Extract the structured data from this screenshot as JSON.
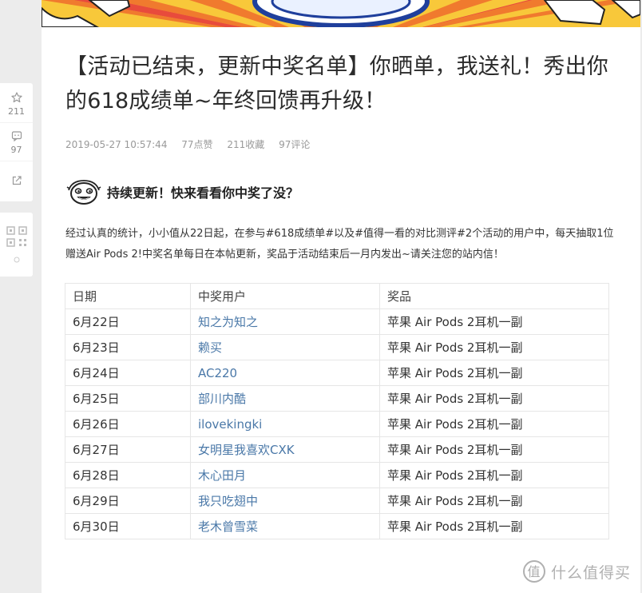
{
  "sidebar": {
    "favorite": {
      "icon": "star-icon",
      "count": "211"
    },
    "comment": {
      "icon": "comment-icon",
      "count": "97"
    },
    "share": {
      "icon": "share-icon"
    },
    "qr": {
      "icon": "qr-code-icon"
    }
  },
  "article": {
    "title": "【活动已结束，更新中奖名单】你晒单，我送礼！秀出你的618成绩单~年终回馈再升级！",
    "meta": {
      "timestamp": "2019-05-27 10:57:44",
      "likes": "77点赞",
      "favorites": "211收藏",
      "comments": "97评论"
    },
    "section_heading": "持续更新！快来看看你中奖了没？",
    "intro": "经过认真的统计，小小值从22日起，在参与#618成绩单#以及#值得一看的对比测评#2个活动的用户中，每天抽取1位赠送Air Pods 2!中奖名单每日在本帖更新，奖品于活动结束后一月内发出~请关注您的站内信！",
    "table": {
      "headers": [
        "日期",
        "中奖用户",
        "奖品"
      ],
      "rows": [
        {
          "date": "6月22日",
          "user": "知之为知之",
          "prize": "苹果 Air Pods 2耳机一副"
        },
        {
          "date": "6月23日",
          "user": "赖买",
          "prize": "苹果 Air Pods 2耳机一副"
        },
        {
          "date": "6月24日",
          "user": "AC220",
          "prize": "苹果 Air Pods 2耳机一副"
        },
        {
          "date": "6月25日",
          "user": "部川内酷",
          "prize": "苹果 Air Pods 2耳机一副"
        },
        {
          "date": "6月26日",
          "user": "ilovekingki",
          "prize": "苹果 Air Pods 2耳机一副"
        },
        {
          "date": "6月27日",
          "user": "女明星我喜欢CXK",
          "prize": "苹果 Air Pods 2耳机一副"
        },
        {
          "date": "6月28日",
          "user": "木心田月",
          "prize": "苹果 Air Pods 2耳机一副"
        },
        {
          "date": "6月29日",
          "user": "我只吃翅中",
          "prize": "苹果 Air Pods 2耳机一副"
        },
        {
          "date": "6月30日",
          "user": "老木曾雪菜",
          "prize": "苹果 Air Pods 2耳机一副"
        }
      ]
    }
  },
  "watermark": {
    "icon": "smzdm-logo-icon",
    "text": "什么值得买"
  },
  "colors": {
    "link": "#4a78a8",
    "banner": "#f8c83a",
    "meta": "#999999"
  }
}
